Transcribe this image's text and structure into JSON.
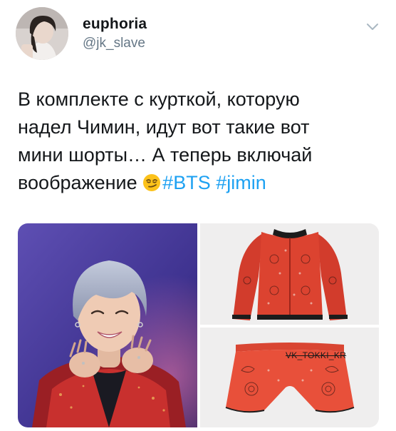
{
  "author": {
    "display_name": "euphoria",
    "handle": "@jk_slave",
    "avatar_icon": "profile-avatar"
  },
  "menu": {
    "icon": "chevron-down-icon"
  },
  "tweet": {
    "line1": "В комплекте с курткой, которую",
    "line2": "надел Чимин, идут вот такие вот",
    "line3": "мини шорты… А теперь включай",
    "line4_text": "воображение",
    "emoji": "smirking-face-emoji",
    "hashtags": [
      "#BTS",
      "#jimin"
    ]
  },
  "media": {
    "watermark": "VK_TOKKI_KR",
    "colors": {
      "jacket_red": "#d8402e",
      "shorts_red": "#e8503a",
      "photo_bg": "#4c3f9f",
      "hair": "#aab3c8",
      "hashtag_blue": "#1da1f2"
    }
  }
}
